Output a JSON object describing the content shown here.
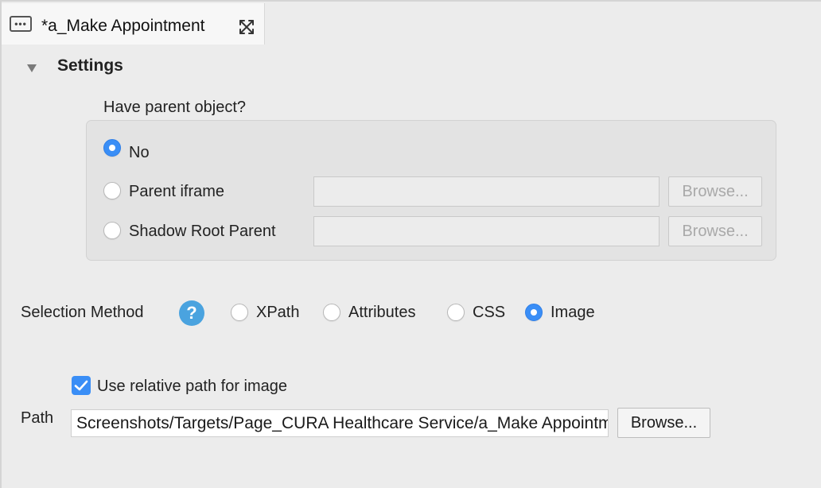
{
  "tab": {
    "title": "*a_Make Appointment",
    "menu_icon": "ellipsis-box-icon",
    "close_icon": "close-icon"
  },
  "settings": {
    "title": "Settings",
    "collapse_icon": "triangle-down-icon"
  },
  "parent": {
    "question": "Have parent object?",
    "options": [
      {
        "label": "No",
        "checked": true
      },
      {
        "label": "Parent iframe",
        "checked": false,
        "value": "",
        "browse_label": "Browse...",
        "enabled": false
      },
      {
        "label": "Shadow Root Parent",
        "checked": false,
        "value": "",
        "browse_label": "Browse...",
        "enabled": false
      }
    ]
  },
  "selection": {
    "label": "Selection Method",
    "help_icon": "help-icon",
    "help_glyph": "?",
    "options": [
      {
        "label": "XPath",
        "checked": false
      },
      {
        "label": "Attributes",
        "checked": false
      },
      {
        "label": "CSS",
        "checked": false
      },
      {
        "label": "Image",
        "checked": true
      }
    ]
  },
  "image": {
    "relative_label": "Use relative path for image",
    "relative_checked": true,
    "path_label": "Path",
    "path_value": "Screenshots/Targets/Page_CURA Healthcare Service/a_Make Appointment",
    "browse_label": "Browse..."
  },
  "colors": {
    "accent": "#3a8ef6",
    "help": "#4aa3df",
    "background": "#ececec"
  }
}
